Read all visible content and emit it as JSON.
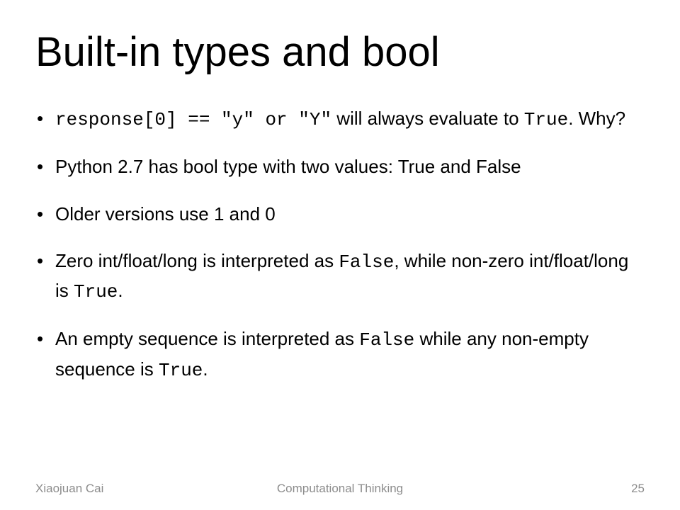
{
  "title": "Built-in types and bool",
  "bullets": [
    {
      "parts": [
        {
          "text": "response[0] == \"y\" or \"Y\"",
          "code": true
        },
        {
          "text": " will always evaluate to ",
          "code": false
        },
        {
          "text": "True",
          "code": true
        },
        {
          "text": ". Why?",
          "code": false
        }
      ]
    },
    {
      "parts": [
        {
          "text": "Python 2.7 has bool type with two values: True and False",
          "code": false
        }
      ]
    },
    {
      "parts": [
        {
          "text": "Older versions use 1 and 0",
          "code": false
        }
      ]
    },
    {
      "parts": [
        {
          "text": "Zero int/float/long is interpreted as ",
          "code": false
        },
        {
          "text": "False",
          "code": true
        },
        {
          "text": ", while non-zero int/float/long is ",
          "code": false
        },
        {
          "text": "True",
          "code": true
        },
        {
          "text": ".",
          "code": false
        }
      ]
    },
    {
      "parts": [
        {
          "text": "An empty sequence is interpreted as ",
          "code": false
        },
        {
          "text": "False",
          "code": true
        },
        {
          "text": " while any non-empty sequence is ",
          "code": false
        },
        {
          "text": "True",
          "code": true
        },
        {
          "text": ".",
          "code": false
        }
      ]
    }
  ],
  "footer": {
    "author": "Xiaojuan Cai",
    "course": "Computational Thinking",
    "page": "25"
  }
}
